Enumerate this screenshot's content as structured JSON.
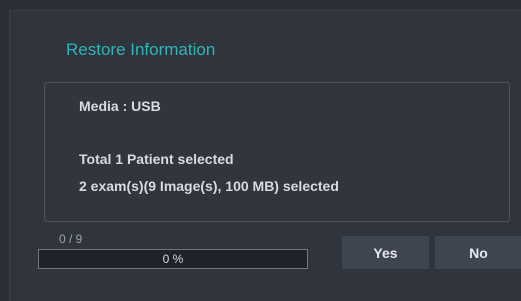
{
  "dialog": {
    "title": "Restore Information",
    "media_line": "Media : USB",
    "total_line": "Total 1 Patient selected",
    "exams_line": "2 exam(s)(9 Image(s), 100 MB) selected"
  },
  "progress": {
    "count_text": "0 / 9",
    "percent_text": "0 %",
    "fraction": 0
  },
  "buttons": {
    "yes_label": "Yes",
    "no_label": "No"
  },
  "colors": {
    "title": "#2fb5b8",
    "background": "#2b3038"
  }
}
